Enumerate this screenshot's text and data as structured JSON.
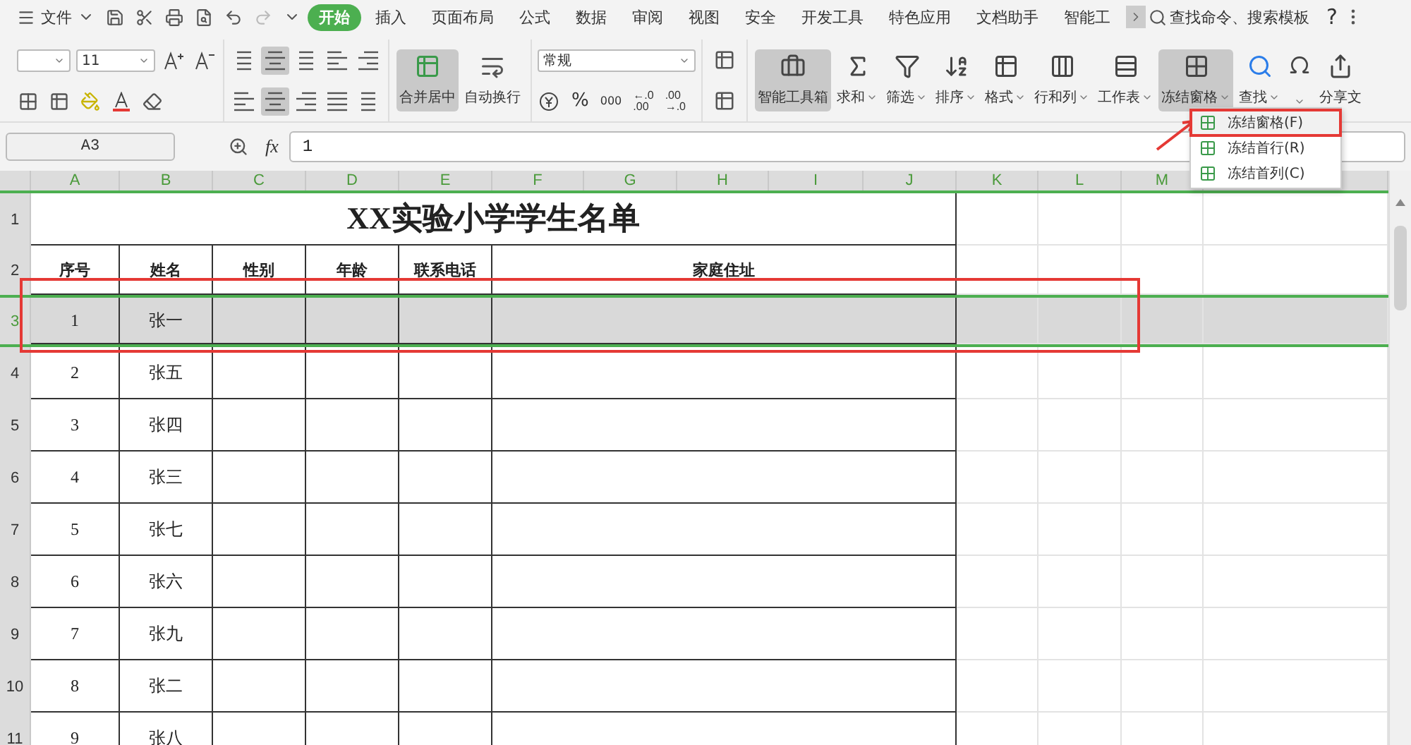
{
  "menu_bar": {
    "file_label": "文件",
    "tabs": [
      {
        "label": "开始",
        "selected": true
      },
      {
        "label": "插入",
        "selected": false
      },
      {
        "label": "页面布局",
        "selected": false
      },
      {
        "label": "公式",
        "selected": false
      },
      {
        "label": "数据",
        "selected": false
      },
      {
        "label": "审阅",
        "selected": false
      },
      {
        "label": "视图",
        "selected": false
      },
      {
        "label": "安全",
        "selected": false
      },
      {
        "label": "开发工具",
        "selected": false
      },
      {
        "label": "特色应用",
        "selected": false
      },
      {
        "label": "文档助手",
        "selected": false
      },
      {
        "label": "智能工",
        "selected": false
      }
    ],
    "search_placeholder": "查找命令、搜索模板",
    "help": "?"
  },
  "ribbon": {
    "font_size": "11",
    "merge_button": {
      "label": "合并居中",
      "active": true
    },
    "wrap_button": {
      "label": "自动换行",
      "active": false
    },
    "number_format": "常规",
    "percent": "%",
    "thousands": "000",
    "add_decimal": [
      "←.0",
      ".00"
    ],
    "remove_decimal": [
      ".00",
      "→.0"
    ],
    "tools": [
      {
        "kind": "toolbox",
        "label": "智能工具箱",
        "active": true,
        "dropdown": false
      },
      {
        "kind": "sum",
        "label": "求和",
        "active": false,
        "dropdown": true
      },
      {
        "kind": "filter",
        "label": "筛选",
        "active": false,
        "dropdown": true
      },
      {
        "kind": "sort",
        "label": "排序",
        "active": false,
        "dropdown": true
      },
      {
        "kind": "format",
        "label": "格式",
        "active": false,
        "dropdown": true
      },
      {
        "kind": "rowcol",
        "label": "行和列",
        "active": false,
        "dropdown": true
      },
      {
        "kind": "sheet",
        "label": "工作表",
        "active": false,
        "dropdown": true
      },
      {
        "kind": "freeze",
        "label": "冻结窗格",
        "active": true,
        "dropdown": true
      },
      {
        "kind": "find",
        "label": "查找",
        "active": false,
        "dropdown": true
      },
      {
        "kind": "symbol",
        "active": false,
        "dropdown": true
      },
      {
        "kind": "share",
        "label": "分享文",
        "active": false,
        "dropdown": false
      }
    ]
  },
  "formula_bar": {
    "cell_ref": "A3",
    "fx": "fx",
    "value": "1"
  },
  "sheet": {
    "columns": [
      "A",
      "B",
      "C",
      "D",
      "E",
      "F",
      "G",
      "H",
      "I",
      "J",
      "K",
      "L",
      "M"
    ],
    "row_numbers": [
      "1",
      "2",
      "3",
      "4",
      "5",
      "6",
      "7",
      "8",
      "9",
      "10",
      "11"
    ],
    "title": "XX实验小学学生名单",
    "headers": [
      "序号",
      "姓名",
      "性别",
      "年龄",
      "联系电话",
      "家庭住址"
    ],
    "rows": [
      {
        "cells": [
          "1",
          "张一"
        ],
        "selected": true
      },
      {
        "cells": [
          "2",
          "张五"
        ],
        "selected": false
      },
      {
        "cells": [
          "3",
          "张四"
        ],
        "selected": false
      },
      {
        "cells": [
          "4",
          "张三"
        ],
        "selected": false
      },
      {
        "cells": [
          "5",
          "张七"
        ],
        "selected": false
      },
      {
        "cells": [
          "6",
          "张六"
        ],
        "selected": false
      },
      {
        "cells": [
          "7",
          "张九"
        ],
        "selected": false
      },
      {
        "cells": [
          "8",
          "张二"
        ],
        "selected": false
      },
      {
        "cells": [
          "9",
          "张八"
        ],
        "selected": false
      }
    ]
  },
  "freeze_menu": {
    "items": [
      {
        "label": "冻结窗格(F)",
        "highlighted": true
      },
      {
        "label": "冻结首行(R)",
        "highlighted": false
      },
      {
        "label": "冻结首列(C)",
        "highlighted": false
      }
    ]
  }
}
